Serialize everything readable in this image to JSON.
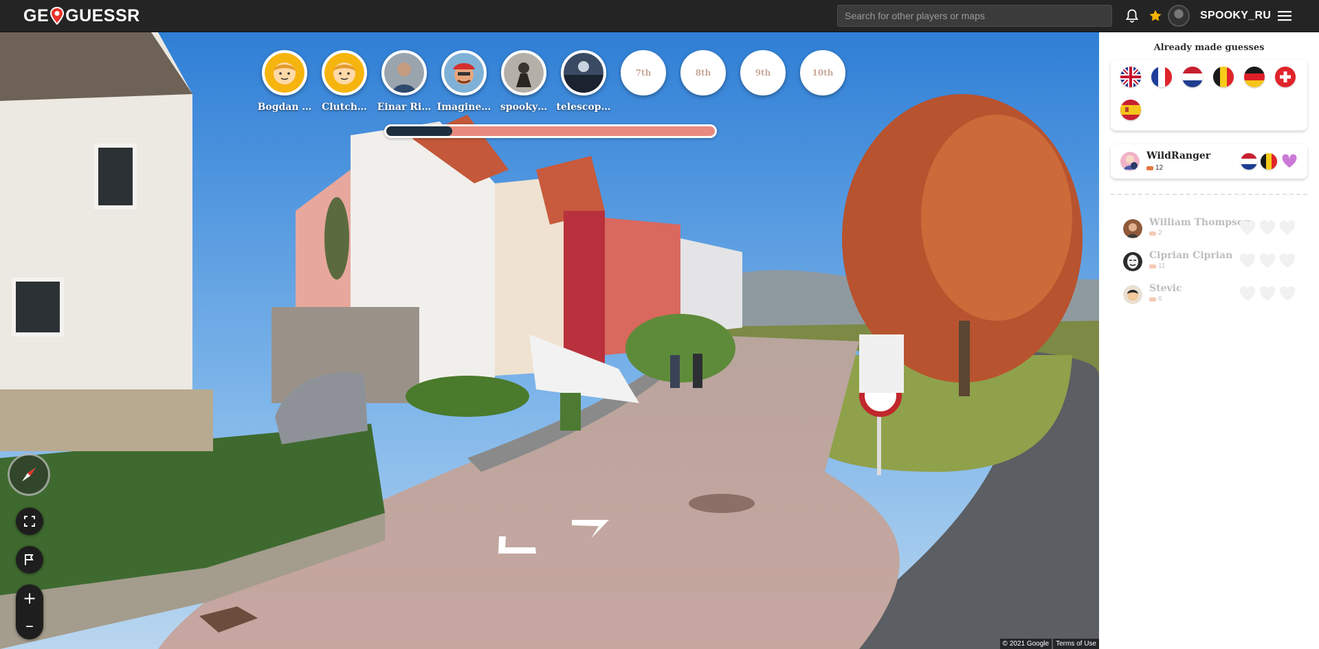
{
  "header": {
    "logo_text_left": "GE",
    "logo_text_right": "GUESSR",
    "search_placeholder": "Search for other players or maps",
    "username": "SPOOKY_RU"
  },
  "players": [
    {
      "name": "Bogdan …"
    },
    {
      "name": "Clutch…"
    },
    {
      "name": "Einar Ri…"
    },
    {
      "name": "Imagine…"
    },
    {
      "name": "spooky…"
    },
    {
      "name": "telescop…"
    },
    {
      "name": ""
    },
    {
      "name": ""
    },
    {
      "name": ""
    },
    {
      "name": ""
    }
  ],
  "empty_slots": [
    "7th",
    "8th",
    "9th",
    "10th"
  ],
  "round_progress": 0.2,
  "map_attribution": {
    "copyright": "© 2021 Google",
    "terms": "Terms of Use"
  },
  "panel": {
    "title": "Already made guesses",
    "guessed_flags": [
      "united-kingdom",
      "france",
      "netherlands",
      "belgium",
      "germany",
      "switzerland",
      "spain"
    ],
    "active_player": {
      "name": "WildRanger",
      "level": "12",
      "flags": [
        "netherlands",
        "belgium"
      ],
      "hearts": 1
    },
    "waiting_players": [
      {
        "name": "William Thompson",
        "level": "2"
      },
      {
        "name": "Ciprian Ciprian",
        "level": "11"
      },
      {
        "name": "Stevic",
        "level": "6"
      }
    ]
  },
  "colors": {
    "accent_red": "#e8332a",
    "progress_dark": "#1d2f3d",
    "progress_light": "#e88a80",
    "heart_purple": "#c97ad6"
  }
}
